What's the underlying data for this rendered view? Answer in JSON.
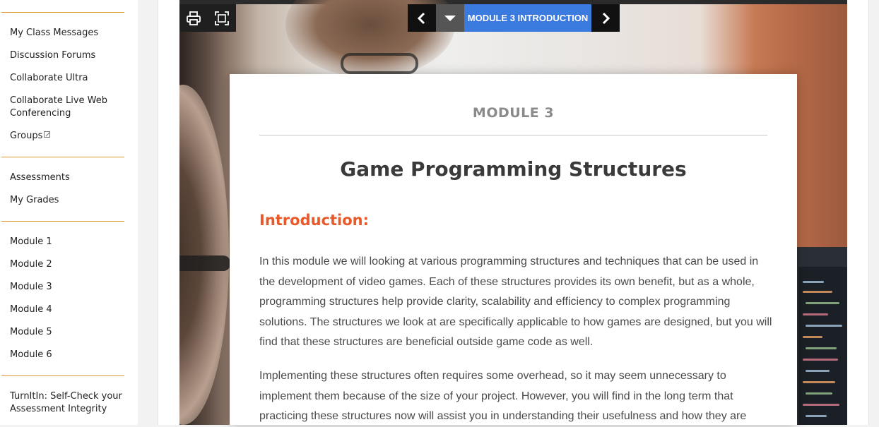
{
  "sidebar": {
    "groups": [
      {
        "items": [
          {
            "label": "My Class Messages"
          },
          {
            "label": "Discussion Forums"
          },
          {
            "label": "Collaborate Ultra"
          },
          {
            "label": "Collaborate Live Web Conferencing"
          },
          {
            "label": "Groups",
            "icon": "external-link-icon"
          }
        ]
      },
      {
        "items": [
          {
            "label": "Assessments"
          },
          {
            "label": "My Grades"
          }
        ]
      },
      {
        "items": [
          {
            "label": "Module 1"
          },
          {
            "label": "Module 2"
          },
          {
            "label": "Module 3"
          },
          {
            "label": "Module 4"
          },
          {
            "label": "Module 5"
          },
          {
            "label": "Module 6"
          }
        ]
      },
      {
        "items": [
          {
            "label": "TurnItIn: Self-Check your Assessment Integrity"
          }
        ]
      }
    ]
  },
  "toolbar": {
    "print_icon": "print-icon",
    "fullscreen_icon": "fullscreen-icon"
  },
  "module_nav": {
    "prev_icon": "chevron-left-icon",
    "menu_icon": "caret-down-icon",
    "title": "MODULE 3 INTRODUCTION",
    "next_icon": "chevron-right-icon"
  },
  "card": {
    "eyebrow": "MODULE 3",
    "title": "Game Programming Structures",
    "section_heading": "Introduction:",
    "paragraphs": [
      "In this module we will looking at various programming structures and techniques that can be used in the development of video games. Each of these structures provides its own benefit, but as a whole, programming structures help provide clarity, scalability and efficiency to complex programming solutions. The structures we look at are specifically applicable to how games are designed, but you will find that these structures are beneficial outside game code as well.",
      "Implementing these structures often requires some overhead, so it may seem unnecessary to implement them because of the size of your project. However, you will find in the long term that practicing these structures now will assist you in understanding their usefulness and how they are"
    ]
  },
  "colors": {
    "accent_orange": "#e8592b",
    "separator_gold": "#d79a2e",
    "nav_blue": "#3b7be0"
  }
}
